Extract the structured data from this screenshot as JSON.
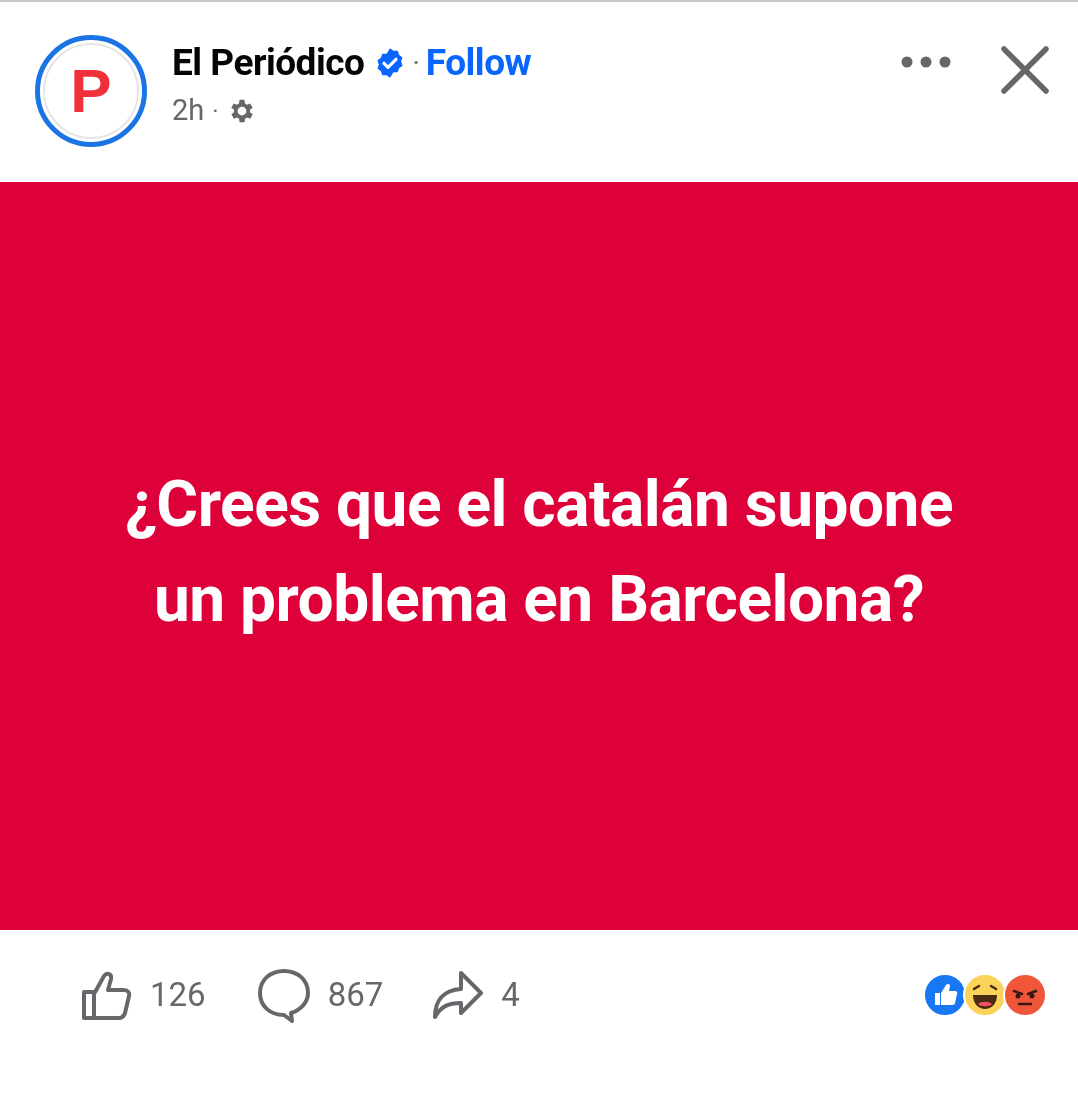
{
  "post": {
    "logo_letter": "P",
    "author": "El Periódico",
    "verified": true,
    "separator": "·",
    "follow": "Follow",
    "time": "2h",
    "time_separator": "·"
  },
  "image_text": "¿Crees que el catalán supone un problema en Barcelona?",
  "actions": [
    {
      "kind": "like",
      "count": "126"
    },
    {
      "kind": "comment",
      "count": "867"
    },
    {
      "kind": "share",
      "count": "4"
    }
  ],
  "reactions": [
    {
      "kind": "like"
    },
    {
      "kind": "haha"
    },
    {
      "kind": "angry"
    }
  ]
}
